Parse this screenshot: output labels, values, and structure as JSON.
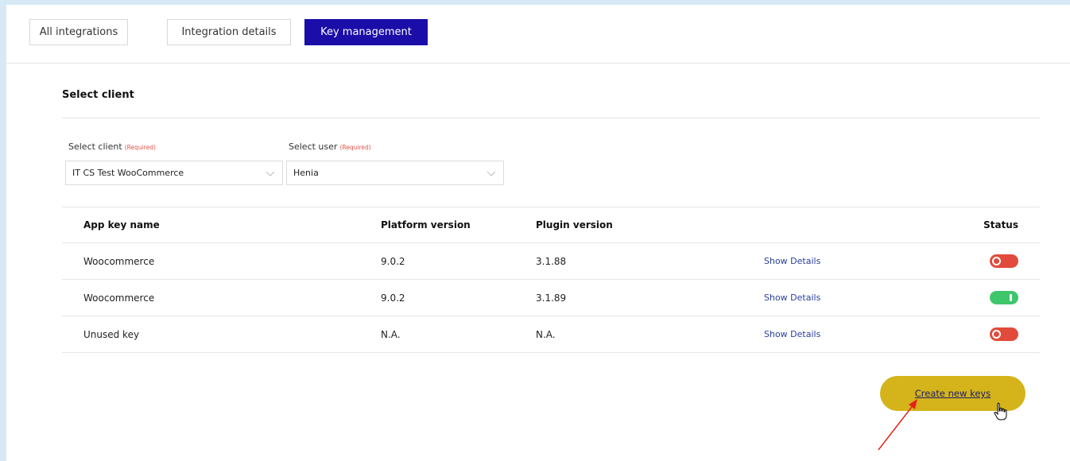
{
  "tabs": [
    {
      "label": "All integrations",
      "active": false
    },
    {
      "label": "Integration details",
      "active": false
    },
    {
      "label": "Key management",
      "active": true
    }
  ],
  "section": {
    "title": "Select client"
  },
  "form": {
    "client_label": "Select client",
    "client_required": "(Required)",
    "client_value": "IT CS Test WooCommerce",
    "user_label": "Select user",
    "user_required": "(Required)",
    "user_value": "Henia"
  },
  "table": {
    "headers": {
      "name": "App key name",
      "platform": "Platform version",
      "plugin": "Plugin version",
      "status": "Status"
    },
    "rows": [
      {
        "name": "Woocommerce",
        "platform": "9.0.2",
        "plugin": "3.1.88",
        "details": "Show Details",
        "status": "off"
      },
      {
        "name": "Woocommerce",
        "platform": "9.0.2",
        "plugin": "3.1.89",
        "details": "Show Details",
        "status": "on"
      },
      {
        "name": "Unused key",
        "platform": "N.A.",
        "plugin": "N.A.",
        "details": "Show Details",
        "status": "off"
      }
    ]
  },
  "actions": {
    "create_label": "Create new keys"
  },
  "colors": {
    "active_tab": "#1a0da8",
    "toggle_on": "#3ec66b",
    "toggle_off": "#e24b3b",
    "create_button": "#d4b41a",
    "annotation_arrow": "#e5231d"
  }
}
